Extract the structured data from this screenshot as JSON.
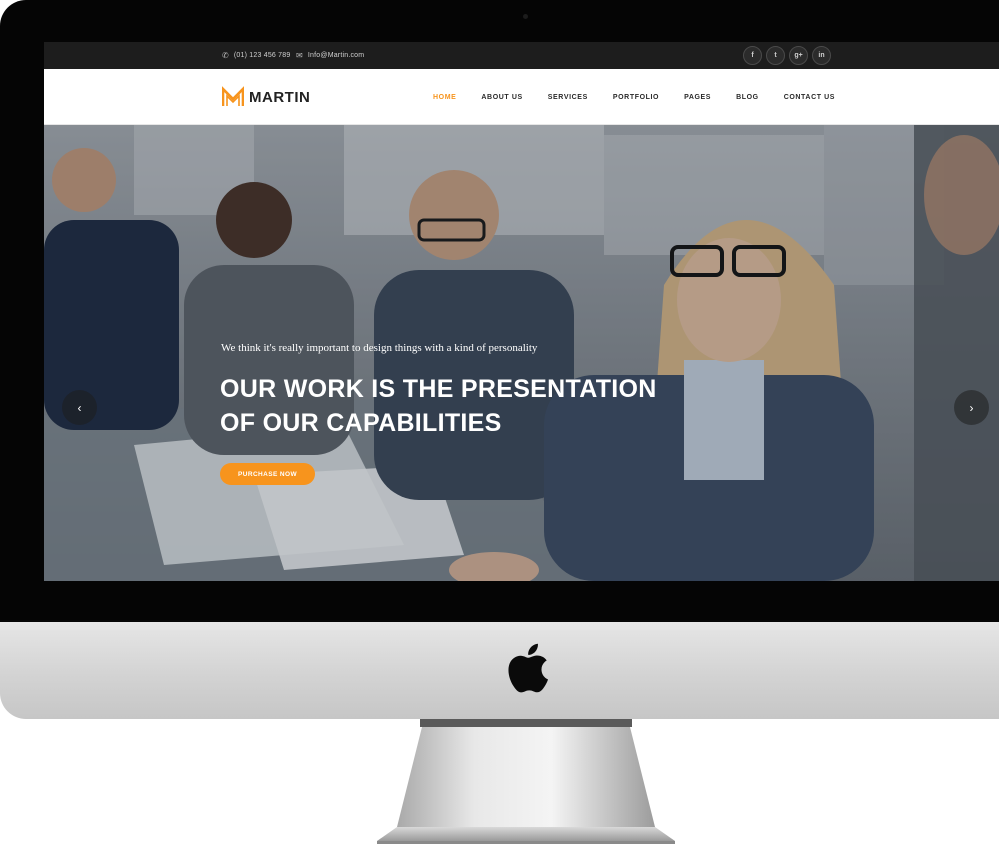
{
  "topbar": {
    "phone": "(01) 123 456 789",
    "email": "Info@Martin.com",
    "socials": [
      {
        "icon": "facebook-icon",
        "glyph": "f"
      },
      {
        "icon": "twitter-icon",
        "glyph": "t"
      },
      {
        "icon": "google-plus-icon",
        "glyph": "g+"
      },
      {
        "icon": "linkedin-icon",
        "glyph": "in"
      }
    ]
  },
  "brand": {
    "name": "MARTIN",
    "accent": "#f7941d"
  },
  "menu": [
    {
      "label": "HOME",
      "active": true
    },
    {
      "label": "ABOUT US",
      "active": false
    },
    {
      "label": "SERVICES",
      "active": false
    },
    {
      "label": "PORTFOLIO",
      "active": false
    },
    {
      "label": "PAGES",
      "active": false
    },
    {
      "label": "BLOG",
      "active": false
    },
    {
      "label": "CONTACT US",
      "active": false
    }
  ],
  "hero": {
    "kicker": "We think it's really important to design things with a kind of personality",
    "title_line1": "OUR WORK IS THE PRESENTATION",
    "title_line2": "OF OUR CAPABILITIES",
    "cta_label": "PURCHASE NOW",
    "prev_glyph": "‹",
    "next_glyph": "›"
  }
}
